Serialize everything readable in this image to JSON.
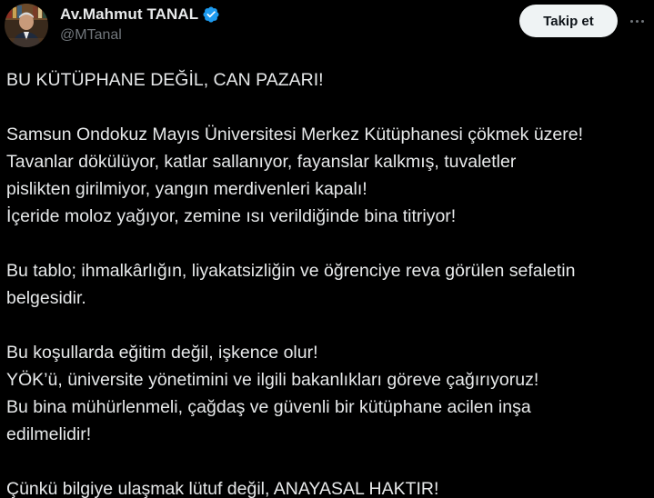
{
  "author": {
    "display_name": "Av.Mahmut TANAL",
    "handle": "@MTanal",
    "verified_icon": "verified-badge-icon",
    "avatar_icon": "profile-photo"
  },
  "actions": {
    "follow_label": "Takip et",
    "more_icon": "more-options-icon"
  },
  "colors": {
    "background": "#000000",
    "text": "#e7e9ea",
    "secondary_text": "#71767b",
    "verified_blue": "#1d9bf0",
    "button_bg": "#eff3f4"
  },
  "tweet": {
    "lines": [
      "BU KÜTÜPHANE DEĞİL, CAN PAZARI!",
      "",
      "Samsun Ondokuz Mayıs Üniversitesi Merkez Kütüphanesi çökmek üzere!",
      "Tavanlar dökülüyor, katlar sallanıyor, fayanslar kalkmış, tuvaletler",
      "pislikten girilmiyor, yangın merdivenleri kapalı!",
      "İçeride moloz yağıyor, zemine ısı verildiğinde bina titriyor!",
      "",
      "Bu tablo; ihmalkârlığın, liyakatsizliğin ve öğrenciye reva görülen sefaletin",
      "belgesidir.",
      "",
      "Bu koşullarda eğitim değil, işkence olur!",
      "YÖK’ü, üniversite yönetimini ve ilgili bakanlıkları göreve çağırıyoruz!",
      "Bu bina mühürlenmeli, çağdaş ve güvenli bir kütüphane acilen inşa",
      "edilmelidir!",
      "",
      "Çünkü bilgiye ulaşmak lütuf değil, ANAYASAL HAKTIR!"
    ]
  }
}
